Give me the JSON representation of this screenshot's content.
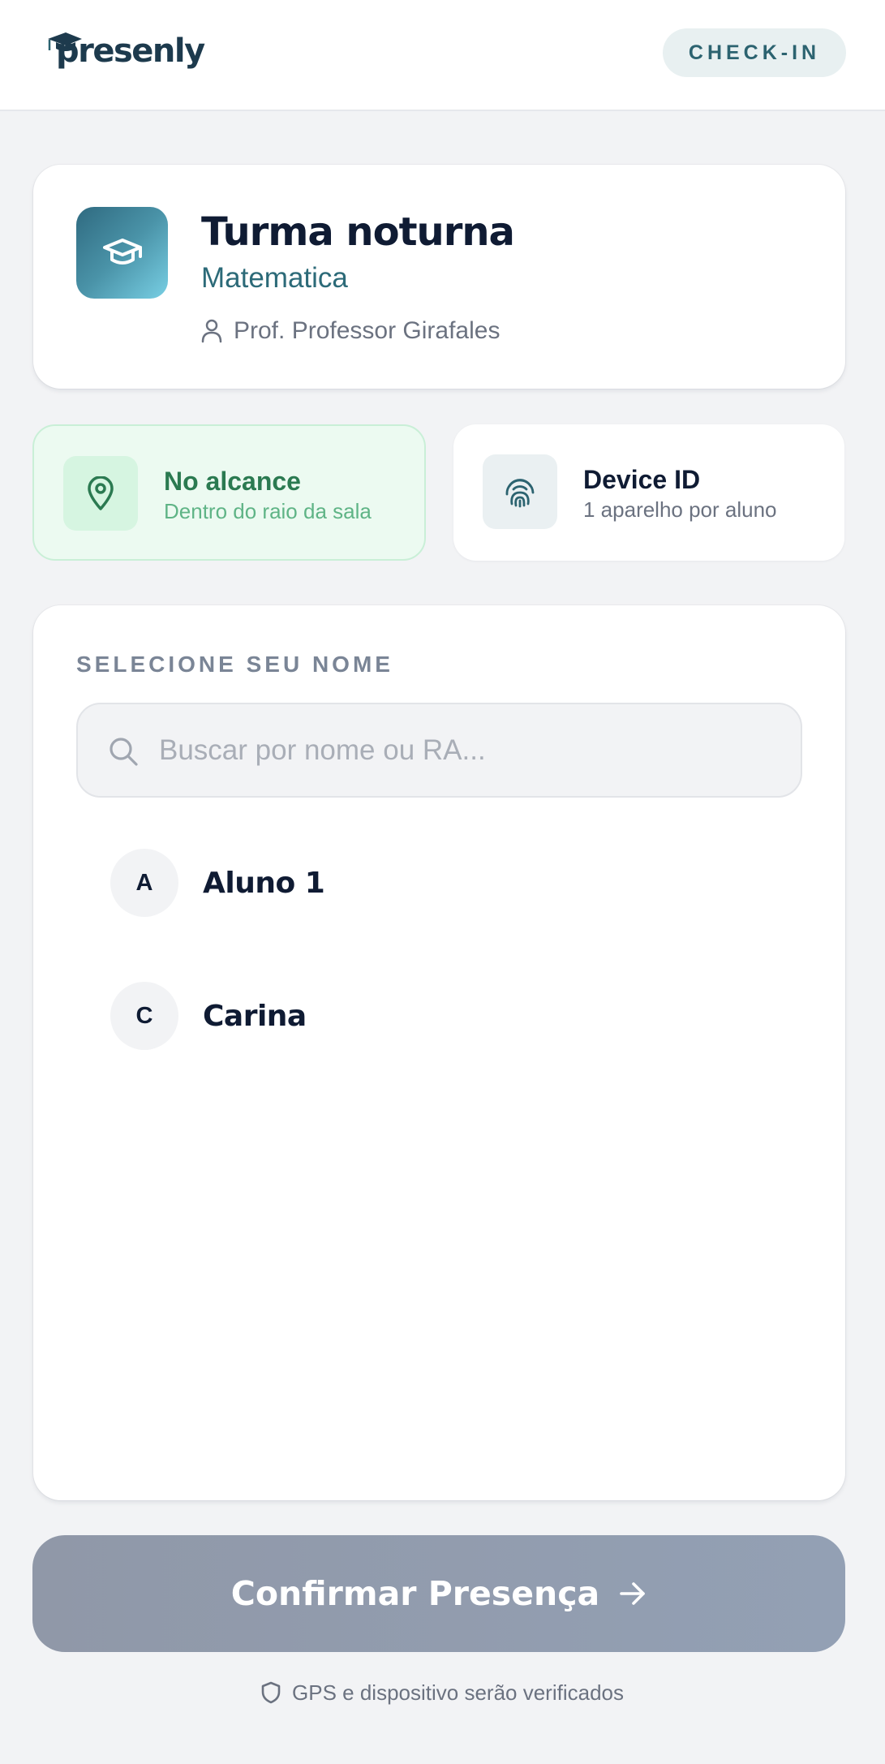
{
  "header": {
    "logo_text": "presenly",
    "checkin_label": "CHECK-IN"
  },
  "class_card": {
    "title": "Turma noturna",
    "subject": "Matematica",
    "professor": "Prof. Professor Girafales",
    "icon": "graduation-cap-icon"
  },
  "status": {
    "range": {
      "title": "No alcance",
      "subtitle": "Dentro do raio da sala",
      "icon": "map-pin-icon",
      "color": "#2b7a51"
    },
    "device": {
      "title": "Device ID",
      "subtitle": "1 aparelho por aluno",
      "icon": "fingerprint-icon"
    }
  },
  "student_list": {
    "section_label": "SELECIONE SEU NOME",
    "search": {
      "placeholder": "Buscar por nome ou RA...",
      "value": ""
    },
    "students": [
      {
        "initial": "A",
        "name": "Aluno 1"
      },
      {
        "initial": "C",
        "name": "Carina"
      }
    ]
  },
  "confirm_button": {
    "label": "Confirmar Presença",
    "icon": "arrow-right-icon"
  },
  "footer": {
    "note": "GPS e dispositivo serão verificados",
    "icon": "shield-icon"
  },
  "colors": {
    "background": "#f2f3f5",
    "accent": "#2c6370",
    "success": "#2b7a51",
    "text": "#0f1b33",
    "button_disabled": "#93a0b4"
  }
}
